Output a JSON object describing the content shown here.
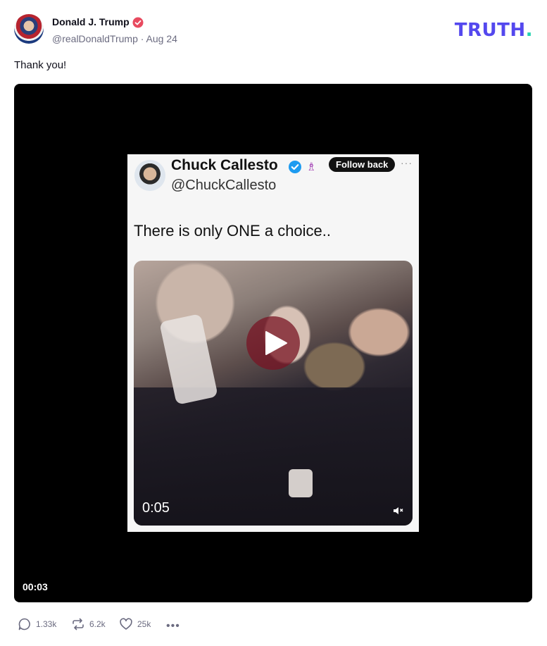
{
  "post": {
    "author_name": "Donald J. Trump",
    "handle_line": "@realDonaldTrump · Aug 24",
    "text": "Thank you!"
  },
  "brand": {
    "logo_text": "TRUTH",
    "logo_dot": ".",
    "accent": "#5448ee",
    "dot_color": "#22d3b0"
  },
  "embed": {
    "name": "Chuck Callesto",
    "handle": "@ChuckCallesto",
    "follow_label": "Follow back",
    "more": "···",
    "text": "There is only ONE a choice..",
    "inner_time": "0:05"
  },
  "video": {
    "time": "00:03"
  },
  "actions": {
    "replies": "1.33k",
    "retruths": "6.2k",
    "likes": "25k"
  },
  "icons": {
    "verified": "verified-badge-icon",
    "play": "play-icon",
    "reply": "reply-icon",
    "retruth": "retruth-icon",
    "like": "heart-icon",
    "more": "more-icon",
    "mute": "speaker-icon"
  }
}
